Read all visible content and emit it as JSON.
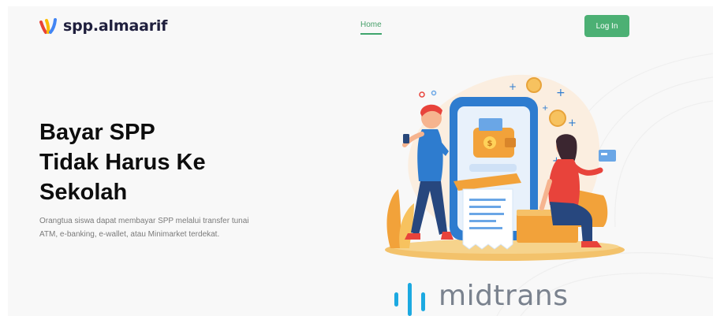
{
  "brand": {
    "name": "spp.almaarif",
    "logo_icon": "almaarif-logo-icon"
  },
  "nav": {
    "home_label": "Home",
    "login_label": "Log In"
  },
  "hero": {
    "title_lines": [
      "Bayar SPP",
      "Tidak Harus Ke",
      "Sekolah"
    ],
    "description_lines": [
      "Orangtua siswa dapat membayar SPP melalui transfer tunai",
      "ATM, e-banking, e-wallet, atau Minimarket terdekat."
    ],
    "illustration": "mobile-payment-illustration"
  },
  "partner": {
    "name": "midtrans",
    "logo_icon": "midtrans-logo-icon"
  },
  "colors": {
    "accent_green": "#4cb074",
    "brand_text": "#1f1f3d",
    "page_bg": "#f8f8f8",
    "illus_blue": "#2e7ccf",
    "illus_orange": "#f2a23a",
    "illus_red": "#e8433b"
  }
}
